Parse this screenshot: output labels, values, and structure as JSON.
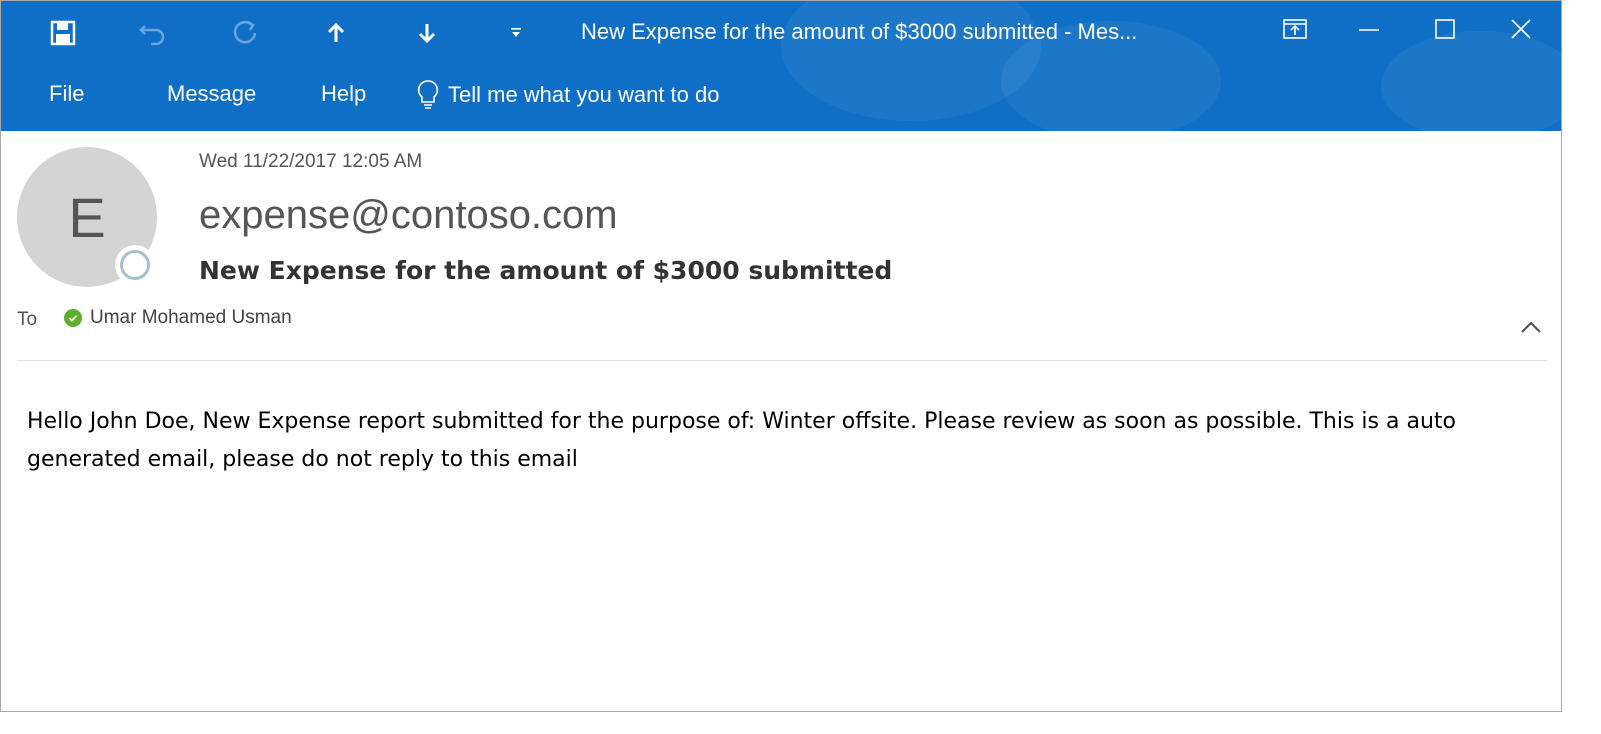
{
  "window": {
    "title": "New Expense for the amount of $3000 submitted  -  Mes...",
    "accent_color": "#0f6fc6"
  },
  "quick_access": [
    {
      "name": "save-icon"
    },
    {
      "name": "undo-icon"
    },
    {
      "name": "redo-icon"
    },
    {
      "name": "previous-item-icon"
    },
    {
      "name": "next-item-icon"
    },
    {
      "name": "customize-toolbar-icon"
    }
  ],
  "window_controls": [
    "restore-ribbon-icon",
    "minimize-icon",
    "maximize-icon",
    "close-icon"
  ],
  "menu": {
    "file": "File",
    "message": "Message",
    "help": "Help",
    "tell_me": "Tell me what you want to do"
  },
  "message": {
    "avatar_initial": "E",
    "date": "Wed 11/22/2017 12:05 AM",
    "sender": "expense@contoso.com",
    "subject": "New Expense for the amount of $3000 submitted",
    "to_label": "To",
    "recipient": "Umar Mohamed Usman",
    "body": "Hello John Doe, New Expense report submitted for the purpose of: Winter offsite. Please review as soon as possible. This is a auto generated email, please do not reply to this email"
  }
}
